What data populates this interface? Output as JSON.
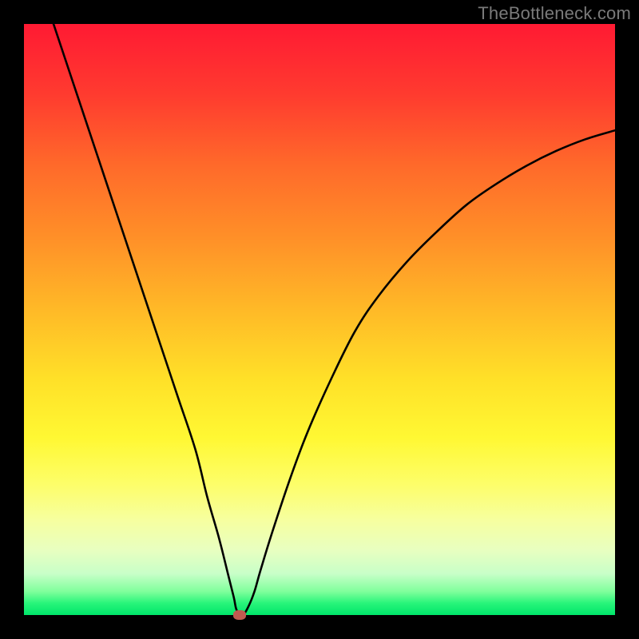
{
  "watermark": "TheBottleneck.com",
  "colors": {
    "frame": "#000000",
    "curve": "#000000",
    "marker": "#c05a50"
  },
  "chart_data": {
    "type": "line",
    "title": "",
    "xlabel": "",
    "ylabel": "",
    "xlim": [
      0,
      100
    ],
    "ylim": [
      0,
      100
    ],
    "grid": false,
    "legend": false,
    "series": [
      {
        "name": "curve",
        "x": [
          5,
          8,
          11,
          14,
          17,
          20,
          23,
          26,
          29,
          31,
          33,
          34.5,
          35.5,
          36,
          37,
          38,
          39,
          40,
          42,
          45,
          48,
          52,
          56,
          60,
          65,
          70,
          75,
          80,
          85,
          90,
          95,
          100
        ],
        "y": [
          100,
          91,
          82,
          73,
          64,
          55,
          46,
          37,
          28,
          20,
          13,
          7,
          3,
          0.8,
          0,
          1.5,
          4,
          7.5,
          14,
          23,
          31,
          40,
          48,
          54,
          60,
          65,
          69.5,
          73,
          76,
          78.5,
          80.5,
          82
        ]
      }
    ],
    "marker": {
      "x": 36.5,
      "y": 0
    }
  }
}
